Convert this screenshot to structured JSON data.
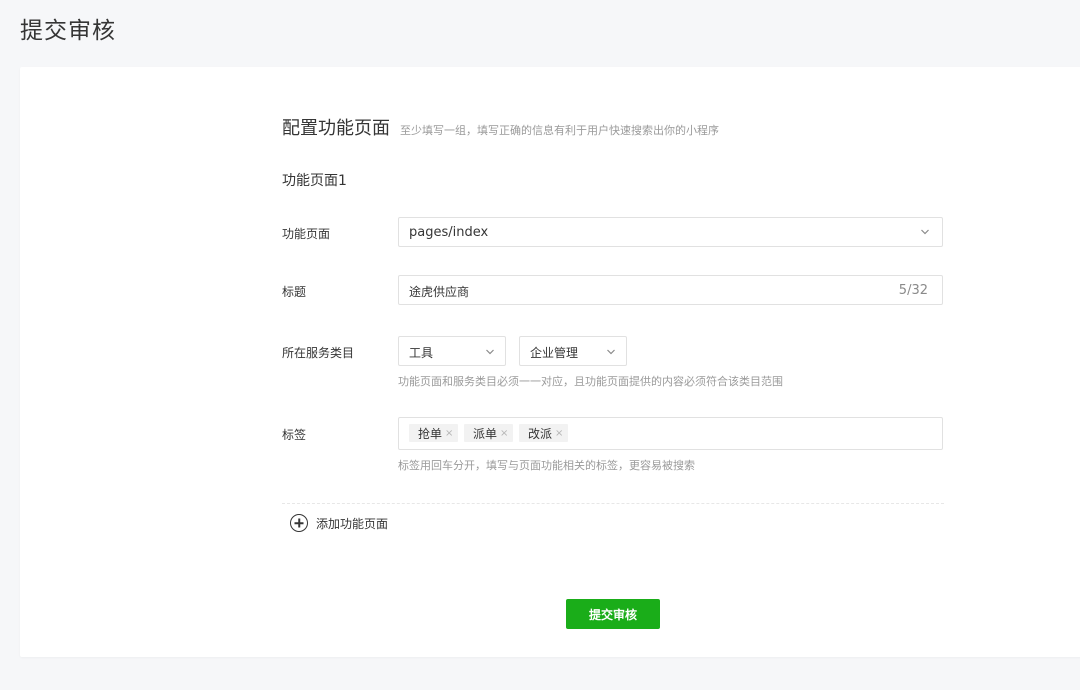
{
  "page": {
    "title": "提交审核"
  },
  "section": {
    "title": "配置功能页面",
    "hint": "至少填写一组，填写正确的信息有利于用户快速搜索出你的小程序"
  },
  "group": {
    "title": "功能页面1"
  },
  "fields": {
    "page_label": "功能页面",
    "page_value": "pages/index",
    "title_label": "标题",
    "title_value": "途虎供应商",
    "title_counter": "5/32",
    "category_label": "所在服务类目",
    "category_primary": "工具",
    "category_secondary": "企业管理",
    "category_hint": "功能页面和服务类目必须一一对应，且功能页面提供的内容必须符合该类目范围",
    "tags_label": "标签",
    "tags": [
      "抢单",
      "派单",
      "改派"
    ],
    "tag_remove": "×",
    "tags_hint": "标签用回车分开，填写与页面功能相关的标签，更容易被搜索"
  },
  "actions": {
    "add_page": "添加功能页面",
    "submit": "提交审核"
  },
  "colors": {
    "primary": "#1aad19",
    "hint": "#9a9a9a",
    "text": "#353535"
  },
  "icons": [
    "chevron-down-icon",
    "plus-circle-icon",
    "close-icon"
  ]
}
